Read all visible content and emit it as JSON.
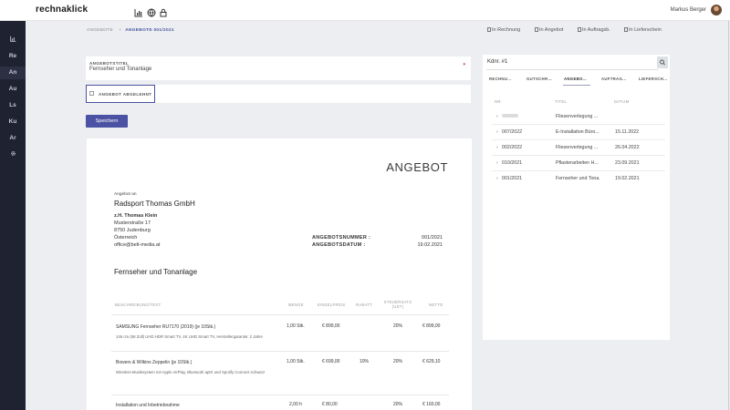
{
  "app": {
    "logo": "rechnaklick"
  },
  "user": {
    "name": "Markus Berger"
  },
  "top_icons": [
    "chart-icon",
    "globe-icon",
    "lock-icon"
  ],
  "sidebar": {
    "items": [
      {
        "label": "",
        "icon": "chart-icon"
      },
      {
        "label": "Re"
      },
      {
        "label": "An"
      },
      {
        "label": "Au"
      },
      {
        "label": "Ls"
      },
      {
        "label": "Ku"
      },
      {
        "label": "Ar"
      },
      {
        "label": "",
        "icon": "gear-icon"
      }
    ]
  },
  "breadcrumb": {
    "parent": "ANGEBOTE",
    "current": "ANGEBOTE 001/2021"
  },
  "convert_links": [
    "In Rechnung",
    "In Angebot",
    "In Auftragsb.",
    "In Lieferschein"
  ],
  "form": {
    "title_label": "ANGEBOTSTITEL",
    "title_value": "Fernseher und Tonanlage",
    "rejected_label": "ANGEBOT ABGELEHNT",
    "save_label": "Speichern"
  },
  "document": {
    "heading": "ANGEBOT",
    "to_label": "Angebot an",
    "company": "Radsport Thomas GmbH",
    "attn": "z.H. Thomas Klein",
    "street": "Musterstraße 17",
    "city": "8750 Judenburg",
    "country": "Österreich",
    "email": "office@belt-media.at",
    "number_label": "ANGEBOTSNUMMER :",
    "number_value": "001/2021",
    "date_label": "ANGEBOTSDATUM :",
    "date_value": "19.02.2021",
    "subject": "Fernseher und Tonanlage",
    "columns": [
      "BESCHREIBUNG/TEXT",
      "MENGE",
      "EINZELPREIS",
      "RABATT",
      "STEUERSATZ (UST)",
      "NETTO"
    ],
    "rows": [
      {
        "title": "SAMSUNG Fernseher RU7170 (2019) (je 10Stk.)",
        "desc": "146 cm (58 Zoll) UHD HDR Smart TV, 4K UHD Smart TV, Herstellergarantie: 2 Jahre",
        "qty": "1,00 Stk.",
        "price": "€ 899,00",
        "discount": "",
        "tax": "20%",
        "net": "€ 899,00"
      },
      {
        "title": "Bowers & Wilkins Zeppelin (je 10Stk.)",
        "desc": "Wireless-Musiksystem mit Apple AirPlay, Bluetooth aptX und Spotify Connect schwarz",
        "qty": "1,00 Stk.",
        "price": "€ 699,00",
        "discount": "10%",
        "tax": "20%",
        "net": "€ 629,10"
      },
      {
        "title": "Installation und Inbetriebnahme",
        "desc": "",
        "qty": "2,00 h",
        "price": "€ 80,00",
        "discount": "",
        "tax": "20%",
        "net": "€ 160,00"
      }
    ]
  },
  "panel": {
    "search_value": "Kdnr. #1",
    "tabs": [
      "RECHNU...",
      "GUTSCHR...",
      "ANGEBO...",
      "AUFTRAG...",
      "LIEFERSCH..."
    ],
    "active_tab": 2,
    "list_headers": [
      "NR.",
      "TITEL",
      "DATUM"
    ],
    "rows": [
      {
        "nr": "",
        "title": "Fliesenverlegung ...",
        "date": ""
      },
      {
        "nr": "007/2022",
        "title": "E-Installation Büro...",
        "date": "15.11.2022"
      },
      {
        "nr": "002/2022",
        "title": "Fliesenverlegung ...",
        "date": "26.04.2022"
      },
      {
        "nr": "010/2021",
        "title": "Pflasterarbeiten H...",
        "date": "23.09.2021"
      },
      {
        "nr": "001/2021",
        "title": "Fernseher und Tona...",
        "date": "19.02.2021"
      }
    ]
  },
  "colors": {
    "accent": "#4b52a3",
    "sidebar": "#1e2231",
    "background": "#eceef1"
  }
}
